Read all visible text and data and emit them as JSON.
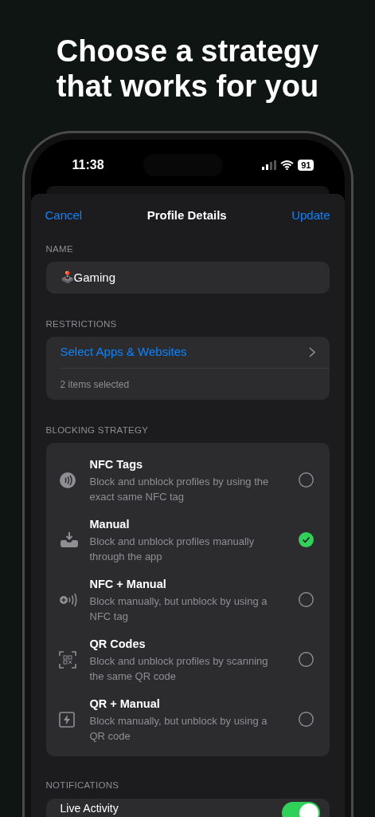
{
  "headline": "Choose a strategy that works for you",
  "status_bar": {
    "time": "11:38",
    "battery": "91"
  },
  "nav": {
    "cancel": "Cancel",
    "title": "Profile Details",
    "update": "Update"
  },
  "name_section": {
    "header": "NAME",
    "emoji": "🕹️",
    "value": "Gaming"
  },
  "restrictions": {
    "header": "RESTRICTIONS",
    "link": "Select Apps & Websites",
    "note": "2 items selected"
  },
  "blocking_strategy": {
    "header": "BLOCKING STRATEGY",
    "options": [
      {
        "kind": "nfc",
        "title": "NFC Tags",
        "description": "Block and unblock profiles by using the exact same NFC tag",
        "selected": false
      },
      {
        "kind": "manual",
        "title": "Manual",
        "description": "Block and unblock profiles manually through the app",
        "selected": true
      },
      {
        "kind": "nfc_manual",
        "title": "NFC + Manual",
        "description": "Block manually, but unblock by using a NFC tag",
        "selected": false
      },
      {
        "kind": "qr",
        "title": "QR Codes",
        "description": "Block and unblock profiles by scanning the same QR code",
        "selected": false
      },
      {
        "kind": "qr_manual",
        "title": "QR + Manual",
        "description": "Block manually, but unblock by using a QR code",
        "selected": false
      }
    ]
  },
  "notifications": {
    "header": "NOTIFICATIONS",
    "rows": [
      {
        "label": "Live Activity",
        "on": true
      }
    ]
  }
}
